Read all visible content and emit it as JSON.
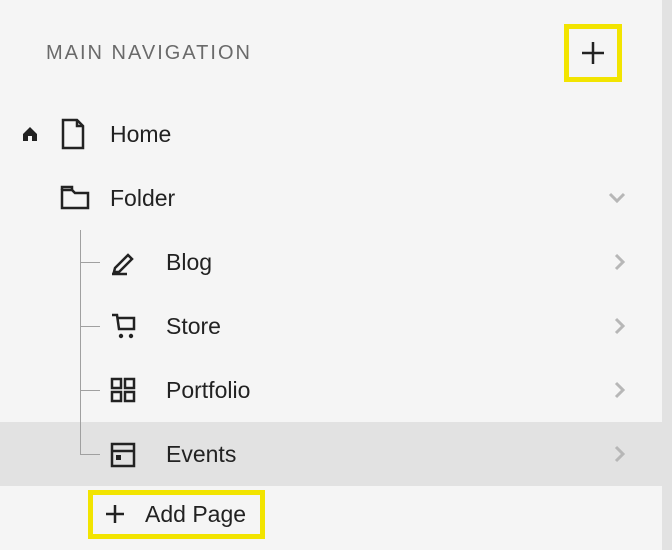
{
  "header": {
    "title": "MAIN NAVIGATION"
  },
  "nav": {
    "home": {
      "label": "Home"
    },
    "folder": {
      "label": "Folder"
    },
    "children": [
      {
        "label": "Blog"
      },
      {
        "label": "Store"
      },
      {
        "label": "Portfolio"
      },
      {
        "label": "Events"
      }
    ],
    "add_page": {
      "label": "Add Page"
    }
  },
  "colors": {
    "highlight": "#f2e400",
    "selected_bg": "#e2e2e2"
  }
}
